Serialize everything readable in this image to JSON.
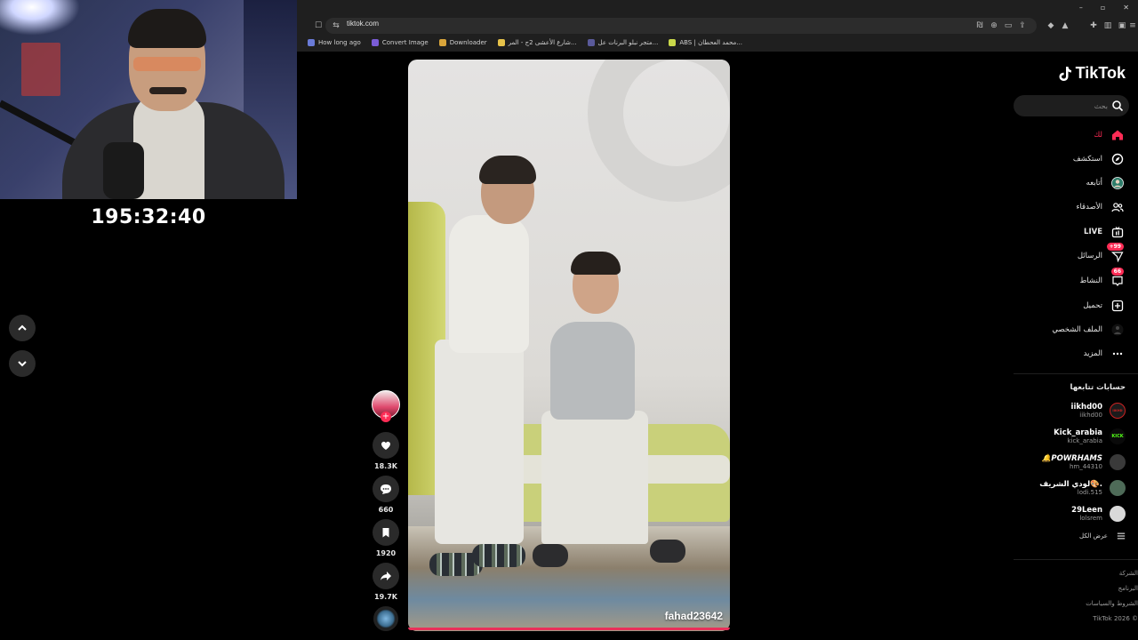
{
  "stream": {
    "timer": "195:32:40"
  },
  "browser": {
    "url": "tiktok.com",
    "window_controls": [
      "–",
      "▫",
      "✕"
    ],
    "bookmarks": [
      {
        "label": "How long ago",
        "color": "#6a7bd8"
      },
      {
        "label": "Convert Image",
        "color": "#7a5cd6"
      },
      {
        "label": "Downloader",
        "color": "#d8a43a"
      },
      {
        "label": "شارع الأعشى 2ج - المر...",
        "color": "#e6c24a"
      },
      {
        "label": "متجر نبلو البرنات عل...",
        "color": "#5a5a9a"
      },
      {
        "label": "ABS | محمد العحطان...",
        "color": "#c9d84a"
      }
    ]
  },
  "tiktok": {
    "logo_text": "TikTok",
    "search_placeholder": "بحث",
    "nav": [
      {
        "label": "لك",
        "icon": "home-icon",
        "active": true
      },
      {
        "label": "استكشف",
        "icon": "compass-icon"
      },
      {
        "label": "أتابعه",
        "icon": "following-avatar-icon"
      },
      {
        "label": "الأصدقاء",
        "icon": "friends-icon"
      },
      {
        "label": "LIVE",
        "icon": "live-icon"
      },
      {
        "label": "الرسائل",
        "icon": "messages-icon",
        "badge": "+99"
      },
      {
        "label": "النشاط",
        "icon": "activity-icon",
        "badge": "66"
      },
      {
        "label": "تحميل",
        "icon": "upload-icon"
      },
      {
        "label": "الملف الشخصي",
        "icon": "profile-avatar-icon"
      },
      {
        "label": "المزيد",
        "icon": "more-icon"
      }
    ],
    "following_title": "حسابات تتابعها",
    "following": [
      {
        "nick": "iikhd00",
        "handle": "iikhd00",
        "avatar_text": "IIKHD"
      },
      {
        "nick": "Kick_arabia",
        "handle": "kick_arabia",
        "avatar_text": "KICK"
      },
      {
        "nick": "🔔POWRHAMS",
        "handle": "hm_44310",
        "avatar_text": ""
      },
      {
        "nick": "لودي الشريف🎨.",
        "handle": "lodi.515",
        "avatar_text": ""
      },
      {
        "nick": "29Leen",
        "handle": "lolsrem",
        "avatar_text": ""
      }
    ],
    "see_all": "عرض الكل",
    "footer": [
      "الشركة",
      "البرنامج",
      "الشروط والسياسات",
      "TikTok 2026 ©"
    ],
    "video": {
      "username": "fahad23642",
      "likes": "18.3K",
      "comments": "660",
      "saves": "1920",
      "shares": "19.7K",
      "progress": 1.0
    }
  },
  "colors": {
    "accent": "#fe2c55",
    "background": "#000000"
  }
}
